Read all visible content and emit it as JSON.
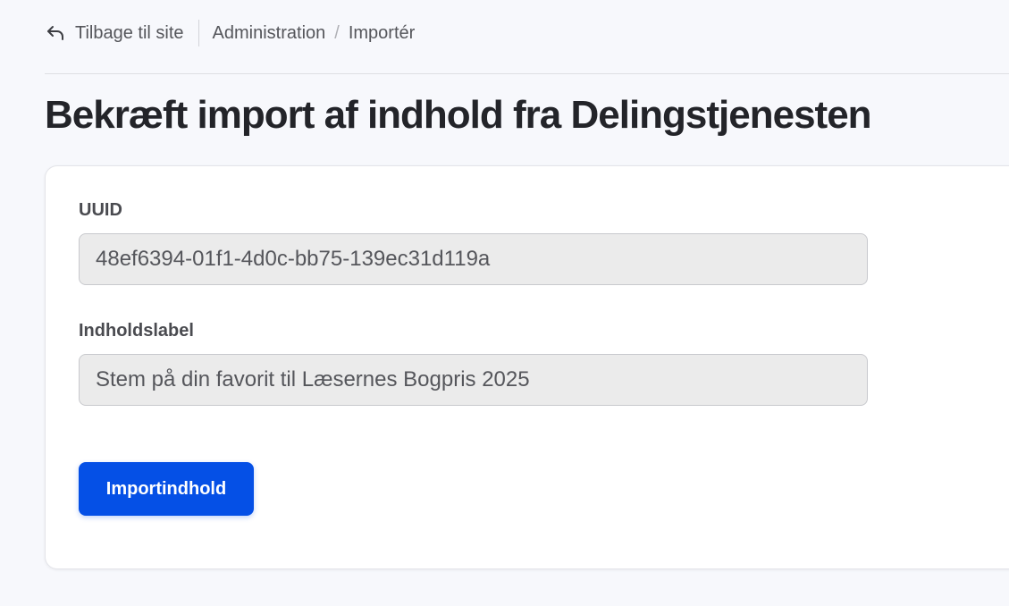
{
  "topbar": {
    "back_label": "Tilbage til site"
  },
  "breadcrumb": {
    "items": [
      "Administration",
      "Importér"
    ],
    "separator": "/"
  },
  "page": {
    "title": "Bekræft import af indhold fra Delingstjenesten"
  },
  "form": {
    "uuid": {
      "label": "UUID",
      "value": "48ef6394-01f1-4d0c-bb75-139ec31d119a"
    },
    "content_label": {
      "label": "Indholdslabel",
      "value": "Stem på din favorit til Læsernes Bogpris 2025"
    },
    "submit_label": "Importindhold"
  },
  "colors": {
    "accent": "#0550e6",
    "background": "#f7f8fc",
    "field_bg": "#ebebeb"
  },
  "icons": {
    "back": "back-arrow-icon"
  }
}
